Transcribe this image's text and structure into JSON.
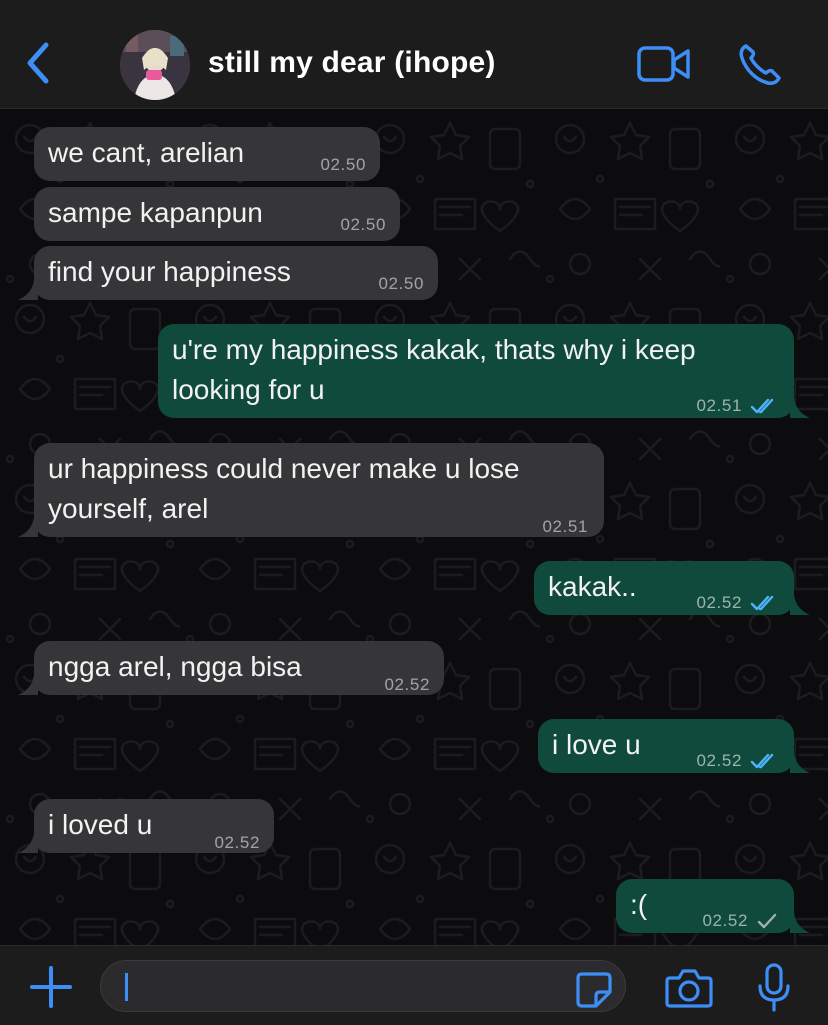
{
  "header": {
    "back_icon": "chevron-left-icon",
    "contact_name": "still my dear (ihope)",
    "video_icon": "video-camera-icon",
    "call_icon": "phone-icon",
    "accent_color": "#3d8ef7"
  },
  "messages": [
    {
      "direction": "incoming",
      "lines": [
        "we cant, arelian"
      ],
      "time": "02.50"
    },
    {
      "direction": "incoming",
      "lines": [
        "sampe kapanpun"
      ],
      "time": "02.50"
    },
    {
      "direction": "incoming",
      "lines": [
        "find your happiness"
      ],
      "time": "02.50"
    },
    {
      "direction": "outgoing",
      "lines": [
        "u're my happiness kakak, thats why i keep",
        "looking for u"
      ],
      "time": "02.51",
      "status": "read"
    },
    {
      "direction": "incoming",
      "lines": [
        "ur happiness could never make u lose",
        "yourself, arel"
      ],
      "time": "02.51"
    },
    {
      "direction": "outgoing",
      "lines": [
        "kakak.."
      ],
      "time": "02.52",
      "status": "read"
    },
    {
      "direction": "incoming",
      "lines": [
        "ngga arel, ngga bisa"
      ],
      "time": "02.52"
    },
    {
      "direction": "outgoing",
      "lines": [
        "i love u"
      ],
      "time": "02.52",
      "status": "read"
    },
    {
      "direction": "incoming",
      "lines": [
        "i loved u"
      ],
      "time": "02.52"
    },
    {
      "direction": "outgoing",
      "lines": [
        ":("
      ],
      "time": "02.52",
      "status": "sent"
    }
  ],
  "input": {
    "plus_icon": "plus-icon",
    "value": "",
    "sticker_icon": "sticker-icon",
    "camera_icon": "camera-icon",
    "mic_icon": "microphone-icon"
  },
  "colors": {
    "incoming_bubble": "#363638",
    "outgoing_bubble": "#0f4a3c",
    "read_tick": "#4fb3ff",
    "sent_tick": "#9fb3ad"
  }
}
